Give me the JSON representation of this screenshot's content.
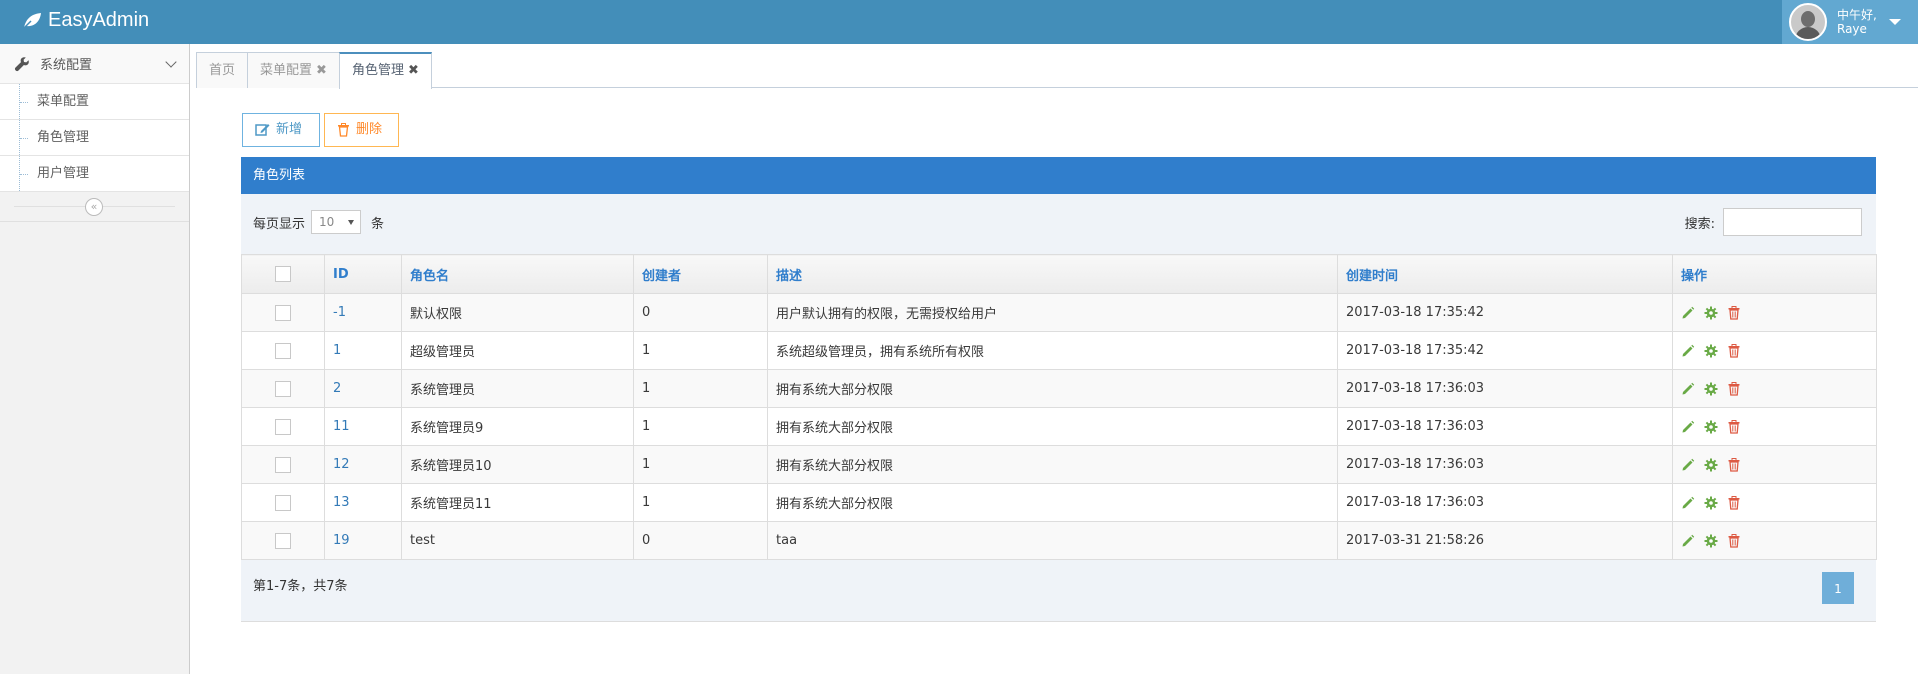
{
  "brand": {
    "name": "EasyAdmin"
  },
  "user": {
    "greeting": "中午好,",
    "name": "Raye"
  },
  "sidebar": {
    "group": "系统配置",
    "items": [
      {
        "label": "菜单配置"
      },
      {
        "label": "角色管理"
      },
      {
        "label": "用户管理"
      }
    ],
    "collapse_glyph": "«"
  },
  "tabs": [
    {
      "label": "首页",
      "closable": false
    },
    {
      "label": "菜单配置",
      "closable": true
    },
    {
      "label": "角色管理",
      "closable": true,
      "active": true
    }
  ],
  "actions": {
    "add_label": "新增",
    "delete_label": "删除"
  },
  "panel": {
    "title": "角色列表"
  },
  "toolbar": {
    "per_page_prefix": "每页显示",
    "per_page_value": "10",
    "per_page_suffix": "条",
    "search_label": "搜索:"
  },
  "table": {
    "columns": [
      "ID",
      "角色名",
      "创建者",
      "描述",
      "创建时间",
      "操作"
    ],
    "rows": [
      {
        "id": "-1",
        "name": "默认权限",
        "creator": "0",
        "desc": "用户默认拥有的权限，无需授权给用户",
        "created": "2017-03-18 17:35:42"
      },
      {
        "id": "1",
        "name": "超级管理员",
        "creator": "1",
        "desc": "系统超级管理员，拥有系统所有权限",
        "created": "2017-03-18 17:35:42"
      },
      {
        "id": "2",
        "name": "系统管理员",
        "creator": "1",
        "desc": "拥有系统大部分权限",
        "created": "2017-03-18 17:36:03"
      },
      {
        "id": "11",
        "name": "系统管理员9",
        "creator": "1",
        "desc": "拥有系统大部分权限",
        "created": "2017-03-18 17:36:03"
      },
      {
        "id": "12",
        "name": "系统管理员10",
        "creator": "1",
        "desc": "拥有系统大部分权限",
        "created": "2017-03-18 17:36:03"
      },
      {
        "id": "13",
        "name": "系统管理员11",
        "creator": "1",
        "desc": "拥有系统大部分权限",
        "created": "2017-03-18 17:36:03"
      },
      {
        "id": "19",
        "name": "test",
        "creator": "0",
        "desc": "taa",
        "created": "2017-03-31 21:58:26"
      }
    ],
    "row_icons": [
      "pencil-icon",
      "gear-icon",
      "trash-icon"
    ]
  },
  "footer": {
    "info": "第1-7条，共7条",
    "current_page": "1"
  },
  "colors": {
    "topbar": "#438eb9",
    "panel_head": "#307ecc",
    "edit": "#69aa46",
    "gear": "#69aa46",
    "trash": "#dd5a43"
  }
}
